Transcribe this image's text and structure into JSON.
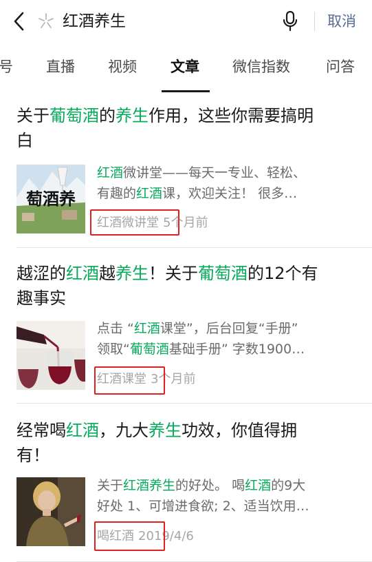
{
  "search": {
    "query": "红酒养生",
    "cancel_label": "取消"
  },
  "tabs": [
    "号",
    "直播",
    "视频",
    "文章",
    "微信指数",
    "问答"
  ],
  "active_tab_index": 3,
  "accent_colors": {
    "highlight": "#07a95b",
    "link": "#576b95",
    "annotation": "#e02020"
  },
  "results": [
    {
      "title_line1": [
        {
          "t": "关于",
          "h": false
        },
        {
          "t": "葡萄酒",
          "h": true
        },
        {
          "t": "的",
          "h": false
        },
        {
          "t": "养生",
          "h": true
        },
        {
          "t": "作用，这些你需要搞明",
          "h": false
        }
      ],
      "title_line2": [
        {
          "t": "白",
          "h": false
        }
      ],
      "snippet_line1": [
        {
          "t": "红酒",
          "h": true
        },
        {
          "t": "微讲堂——每天一专业、轻松、",
          "h": false
        }
      ],
      "snippet_line2": [
        {
          "t": "有趣的",
          "h": false
        },
        {
          "t": "红酒",
          "h": true
        },
        {
          "t": "课，欢迎关注！ 很多…",
          "h": false
        }
      ],
      "source": "红酒微讲堂",
      "time": "5个月前",
      "thumb_text": "萄酒养"
    },
    {
      "title_line1": [
        {
          "t": "越涩的",
          "h": false
        },
        {
          "t": "红酒",
          "h": true
        },
        {
          "t": "越",
          "h": false
        },
        {
          "t": "养生",
          "h": true
        },
        {
          "t": "！关于",
          "h": false
        },
        {
          "t": "葡萄酒",
          "h": true
        },
        {
          "t": "的12个有",
          "h": false
        }
      ],
      "title_line2": [
        {
          "t": "趣事实",
          "h": false
        }
      ],
      "snippet_line1": [
        {
          "t": "点击 “",
          "h": false
        },
        {
          "t": "红酒",
          "h": true
        },
        {
          "t": "课堂”，后台回复“手册”",
          "h": false
        }
      ],
      "snippet_line2": [
        {
          "t": "领取“",
          "h": false
        },
        {
          "t": "葡萄酒",
          "h": true
        },
        {
          "t": "基础手册” 字数1900…",
          "h": false
        }
      ],
      "source": "红酒课堂",
      "time": "3个月前",
      "thumb_text": ""
    },
    {
      "title_line1": [
        {
          "t": "经常喝",
          "h": false
        },
        {
          "t": "红酒",
          "h": true
        },
        {
          "t": "，九大",
          "h": false
        },
        {
          "t": "养生",
          "h": true
        },
        {
          "t": "功效，你值得拥",
          "h": false
        }
      ],
      "title_line2": [
        {
          "t": "有！",
          "h": false
        }
      ],
      "snippet_line1": [
        {
          "t": "关于",
          "h": false
        },
        {
          "t": "红酒",
          "h": true
        },
        {
          "t": "养生",
          "h": true
        },
        {
          "t": "的好处。 喝",
          "h": false
        },
        {
          "t": "红酒",
          "h": true
        },
        {
          "t": "的9大",
          "h": false
        }
      ],
      "snippet_line2": [
        {
          "t": "好处 1、可增进食欲; 2、适当饮用…",
          "h": false
        }
      ],
      "source": "喝红酒",
      "time": "2019/4/6",
      "thumb_text": ""
    }
  ]
}
